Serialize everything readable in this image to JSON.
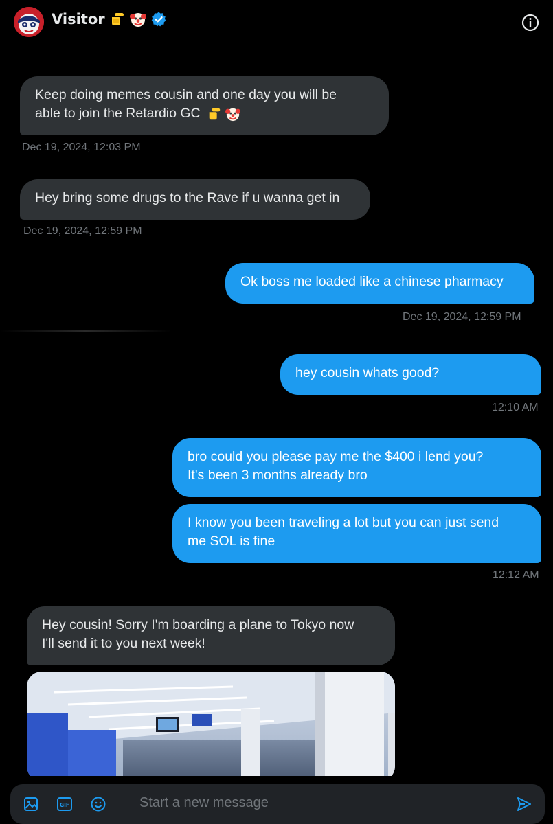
{
  "header": {
    "name": "Visitor",
    "emojis": [
      "pointing-hand-emoji",
      "clown-face-emoji"
    ],
    "verified_badge": "verified-icon",
    "info_icon": "info-icon"
  },
  "messages": [
    {
      "side": "in",
      "text_line1": "Keep doing memes cousin and one day you will be",
      "text_line2": "able to join the Retardio GC",
      "timestamp": "Dec 19, 2024, 12:03 PM"
    },
    {
      "side": "in",
      "text": "Hey bring some drugs to the Rave if u wanna get in",
      "timestamp": "Dec 19, 2024, 12:59 PM"
    },
    {
      "side": "out",
      "text": "Ok boss me loaded like a chinese pharmacy",
      "timestamp": "Dec 19, 2024, 12:59 PM"
    },
    {
      "side": "out",
      "text": "hey cousin whats good?",
      "timestamp": "12:10 AM"
    },
    {
      "side": "out",
      "text_line1": "bro could you please pay me the $400 i lend you?",
      "text_line2": "It's been 3 months already bro"
    },
    {
      "side": "out",
      "text_line1": "I know you been traveling a lot but you can just send",
      "text_line2": "me SOL is fine",
      "timestamp": "12:12 AM"
    },
    {
      "side": "in",
      "text_line1": "Hey cousin! Sorry I'm boarding a plane to Tokyo now",
      "text_line2": "I'll send it to you next week!"
    }
  ],
  "composer": {
    "placeholder": "Start a new message",
    "icons": [
      "image-icon",
      "gif-icon",
      "emoji-icon",
      "send-icon"
    ]
  },
  "colors": {
    "background": "#000000",
    "incoming_bubble": "#2f3336",
    "outgoing_bubble": "#1d9bf0",
    "timestamp": "#71767b",
    "verified": "#1d9bf0"
  }
}
